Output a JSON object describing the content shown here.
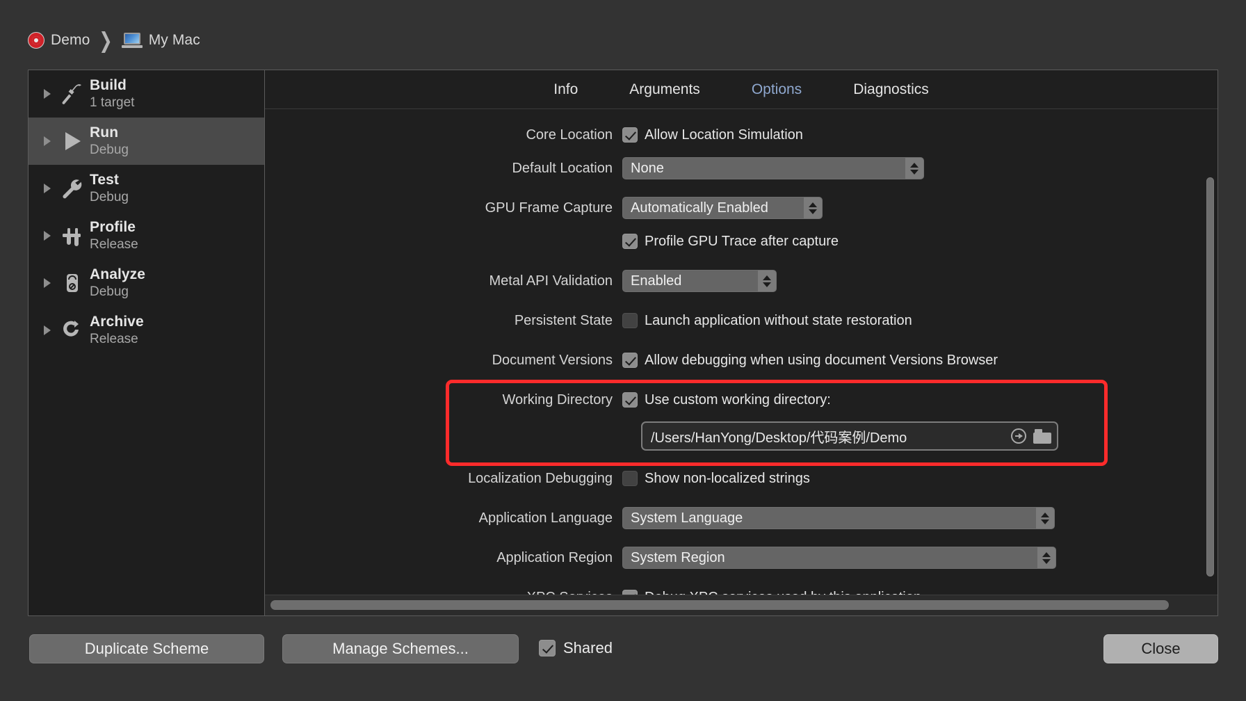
{
  "header": {
    "scheme_name": "Demo",
    "separator": "❯",
    "destination": "My Mac",
    "target_icon": "target-icon",
    "mac_icon": "laptop-icon"
  },
  "sidebar": {
    "items": [
      {
        "title": "Build",
        "subtitle": "1 target",
        "icon": "hammer-icon",
        "selected": false
      },
      {
        "title": "Run",
        "subtitle": "Debug",
        "icon": "play-icon",
        "selected": true
      },
      {
        "title": "Test",
        "subtitle": "Debug",
        "icon": "wrench-icon",
        "selected": false
      },
      {
        "title": "Profile",
        "subtitle": "Release",
        "icon": "caliper-icon",
        "selected": false
      },
      {
        "title": "Analyze",
        "subtitle": "Debug",
        "icon": "analyze-icon",
        "selected": false
      },
      {
        "title": "Archive",
        "subtitle": "Release",
        "icon": "archive-icon",
        "selected": false
      }
    ]
  },
  "tabs": [
    {
      "label": "Info",
      "active": false
    },
    {
      "label": "Arguments",
      "active": false
    },
    {
      "label": "Options",
      "active": true
    },
    {
      "label": "Diagnostics",
      "active": false
    }
  ],
  "options": {
    "core_location": {
      "label": "Core Location",
      "checkbox_label": "Allow Location Simulation",
      "checked": true
    },
    "default_location": {
      "label": "Default Location",
      "value": "None"
    },
    "gpu_frame_capture": {
      "label": "GPU Frame Capture",
      "value": "Automatically Enabled"
    },
    "profile_gpu_trace": {
      "checkbox_label": "Profile GPU Trace after capture",
      "checked": true
    },
    "metal_api_validation": {
      "label": "Metal API Validation",
      "value": "Enabled"
    },
    "persistent_state": {
      "label": "Persistent State",
      "checkbox_label": "Launch application without state restoration",
      "checked": false
    },
    "document_versions": {
      "label": "Document Versions",
      "checkbox_label": "Allow debugging when using document Versions Browser",
      "checked": true
    },
    "working_directory": {
      "label": "Working Directory",
      "checkbox_label": "Use custom working directory:",
      "checked": true,
      "path": "/Users/HanYong/Desktop/代码案例/Demo",
      "reveal_icon": "arrow-right-circle-icon",
      "browse_icon": "folder-icon",
      "highlight_color": "#fc2b2b"
    },
    "localization_debugging": {
      "label": "Localization Debugging",
      "checkbox_label": "Show non-localized strings",
      "checked": false
    },
    "application_language": {
      "label": "Application Language",
      "value": "System Language"
    },
    "application_region": {
      "label": "Application Region",
      "value": "System Region"
    },
    "xpc_services": {
      "label": "XPC Services",
      "checkbox_label": "Debug XPC services used by this application",
      "checked": true
    }
  },
  "footer": {
    "duplicate_scheme": "Duplicate Scheme",
    "manage_schemes": "Manage Schemes...",
    "shared_label": "Shared",
    "shared_checked": true,
    "close": "Close"
  }
}
